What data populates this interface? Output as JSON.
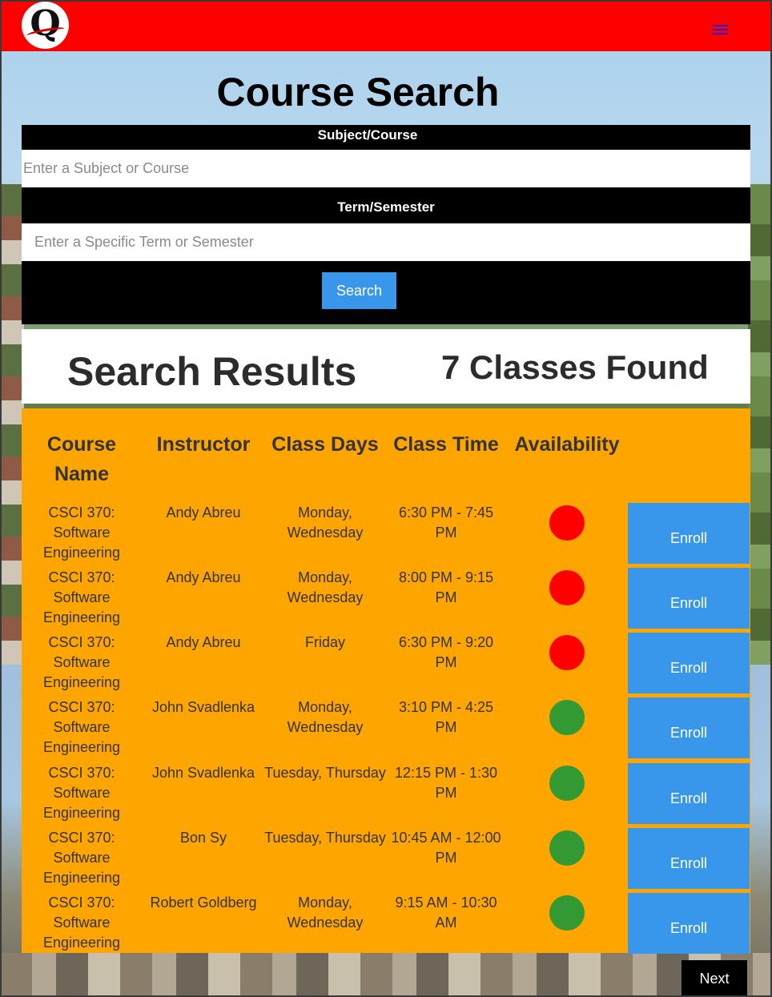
{
  "navbar": {
    "logo_letter": "Q",
    "menu_icon": "hamburger-menu-icon",
    "background_color": "#ff0000"
  },
  "page": {
    "title": "Course Search"
  },
  "search": {
    "subject_label": "Subject/Course",
    "subject_placeholder": "Enter a Subject or Course",
    "subject_value": "",
    "term_label": "Term/Semester",
    "term_placeholder": "Enter a Specific Term or Semester",
    "term_value": "",
    "button_label": "Search"
  },
  "results": {
    "title": "Search Results",
    "count_text": "7 Classes Found",
    "columns": {
      "course_name": "Course Name",
      "instructor": "Instructor",
      "class_days": "Class Days",
      "class_time": "Class Time",
      "availability": "Availability"
    },
    "availability_colors": {
      "full": "#ff0000",
      "open": "#339933"
    },
    "rows": [
      {
        "course": "CSCI 370: Software Engineering",
        "instructor": "Andy Abreu",
        "days": "Monday, Wednesday",
        "time": "6:30 PM - 7:45 PM",
        "availability": "full",
        "action": "Enroll"
      },
      {
        "course": "CSCI 370: Software Engineering",
        "instructor": "Andy Abreu",
        "days": "Monday, Wednesday",
        "time": "8:00 PM - 9:15 PM",
        "availability": "full",
        "action": "Enroll"
      },
      {
        "course": "CSCI 370: Software Engineering",
        "instructor": "Andy Abreu",
        "days": "Friday",
        "time": "6:30 PM - 9:20 PM",
        "availability": "full",
        "action": "Enroll"
      },
      {
        "course": "CSCI 370: Software Engineering",
        "instructor": "John Svadlenka",
        "days": "Monday, Wednesday",
        "time": "3:10 PM - 4:25 PM",
        "availability": "open",
        "action": "Enroll"
      },
      {
        "course": "CSCI 370: Software Engineering",
        "instructor": "John Svadlenka",
        "days": "Tuesday, Thursday",
        "time": "12:15 PM - 1:30 PM",
        "availability": "open",
        "action": "Enroll"
      },
      {
        "course": "CSCI 370: Software Engineering",
        "instructor": "Bon Sy",
        "days": "Tuesday, Thursday",
        "time": "10:45 AM - 12:00 PM",
        "availability": "open",
        "action": "Enroll"
      },
      {
        "course": "CSCI 370: Software Engineering",
        "instructor": "Robert Goldberg",
        "days": "Monday, Wednesday",
        "time": "9:15 AM - 10:30 AM",
        "availability": "open",
        "action": "Enroll"
      }
    ]
  },
  "pagination": {
    "next_label": "Next"
  }
}
